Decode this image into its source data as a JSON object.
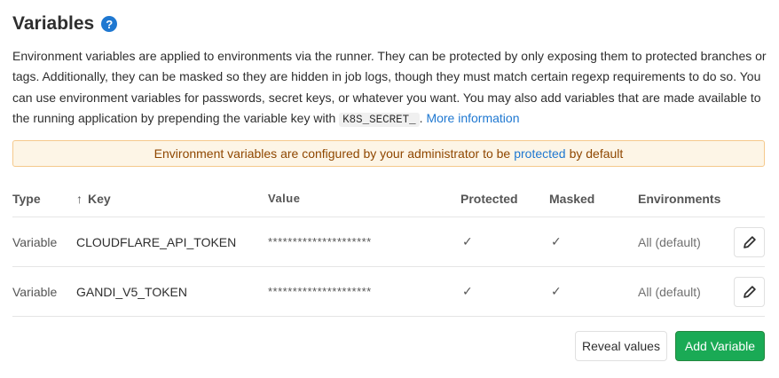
{
  "header": {
    "title": "Variables",
    "help_icon": "question-icon"
  },
  "description": {
    "text": "Environment variables are applied to environments via the runner. They can be protected by only exposing them to protected branches or tags. Additionally, they can be masked so they are hidden in job logs, though they must match certain regexp requirements to do so. You can use environment variables for passwords, secret keys, or whatever you want. You may also add variables that are made available to the running application by prepending the variable key with",
    "code": "K8S_SECRET_",
    "separator": ".",
    "link_label": "More information"
  },
  "alert": {
    "before": "Environment variables are configured by your administrator to be",
    "link": "protected",
    "after": "by default"
  },
  "table": {
    "headers": {
      "type": "Type",
      "key": "Key",
      "value": "Value",
      "protected": "Protected",
      "masked": "Masked",
      "environments": "Environments"
    },
    "rows": [
      {
        "type": "Variable",
        "key": "CLOUDFLARE_API_TOKEN",
        "value": "*********************",
        "protected": "✓",
        "masked": "✓",
        "environments": "All (default)"
      },
      {
        "type": "Variable",
        "key": "GANDI_V5_TOKEN",
        "value": "*********************",
        "protected": "✓",
        "masked": "✓",
        "environments": "All (default)"
      }
    ]
  },
  "actions": {
    "reveal_label": "Reveal values",
    "add_label": "Add Variable"
  },
  "colors": {
    "primary_link": "#1f78d1",
    "alert_bg": "#fdf5e6",
    "alert_text": "#8f4700",
    "add_button": "#1aaa55"
  }
}
